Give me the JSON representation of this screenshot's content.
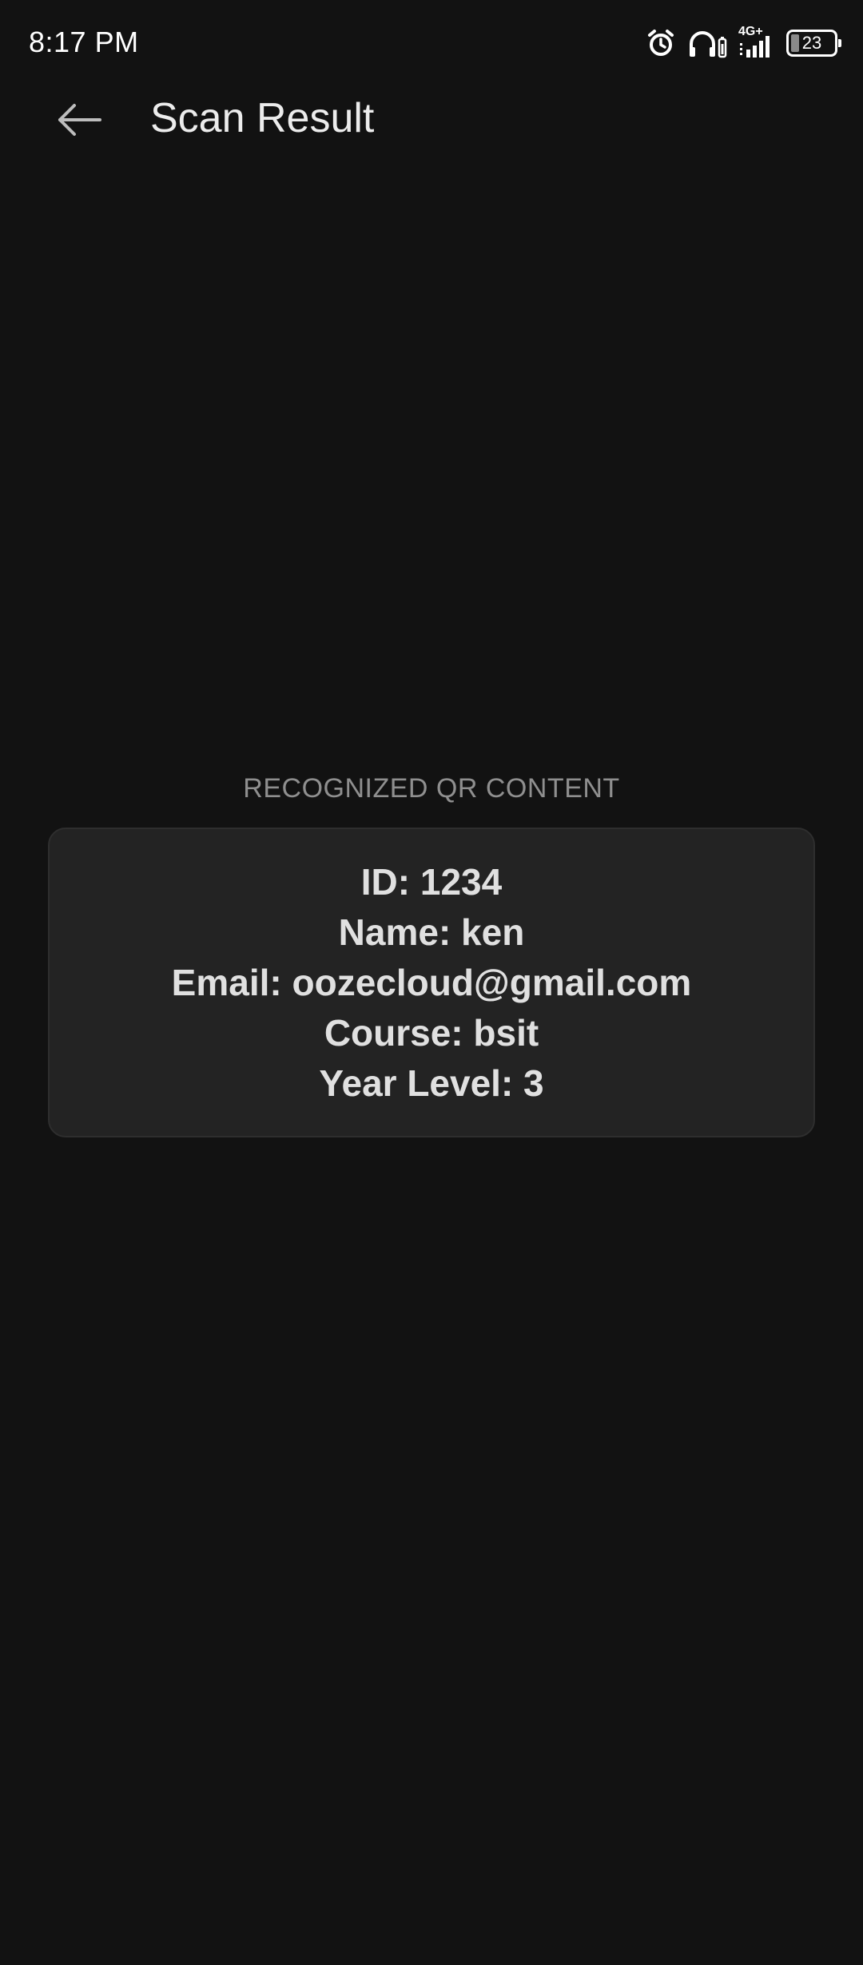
{
  "status_bar": {
    "time": "8:17 PM",
    "network": "4G+",
    "battery_level": "23",
    "icons": [
      "alarm-icon",
      "headphones-icon",
      "signal-icon",
      "battery-icon"
    ]
  },
  "app_bar": {
    "back_icon": "arrow-left-icon",
    "title": "Scan Result"
  },
  "content": {
    "section_label": "RECOGNIZED QR CONTENT",
    "lines": [
      "ID: 1234",
      "Name: ken",
      "Email: oozecloud@gmail.com",
      "Course: bsit",
      "Year Level: 3"
    ]
  },
  "colors": {
    "background": "#121212",
    "card": "#232323",
    "text": "#e0e0e0",
    "label": "#8f8f8f"
  }
}
